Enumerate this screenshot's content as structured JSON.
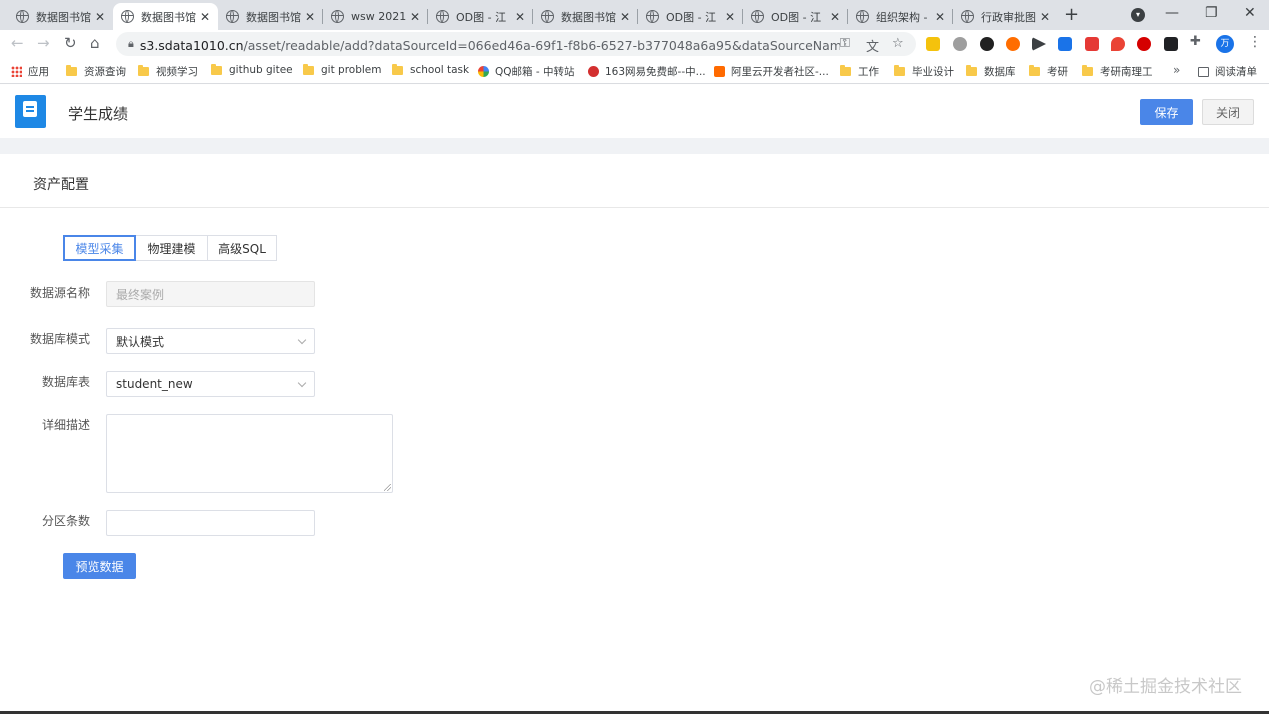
{
  "browser": {
    "tabs": [
      {
        "title": "数据图书馆",
        "active": false
      },
      {
        "title": "数据图书馆",
        "active": true
      },
      {
        "title": "数据图书馆",
        "active": false
      },
      {
        "title": "wsw 2021.",
        "active": false
      },
      {
        "title": "OD图 - 江",
        "active": false
      },
      {
        "title": "数据图书馆",
        "active": false
      },
      {
        "title": "OD图 - 江",
        "active": false
      },
      {
        "title": "OD图 - 江",
        "active": false
      },
      {
        "title": "组织架构 -",
        "active": false
      },
      {
        "title": "行政审批图",
        "active": false
      }
    ],
    "close_glyph": "✕",
    "new_tab_glyph": "+",
    "window_controls": [
      "—",
      "❐",
      "✕"
    ],
    "url_domain": "s3.sdata1010.cn",
    "url_path": "/asset/readable/add?dataSourceId=066ed46a-69f1-f8b6-6527-b377048a6a95&dataSourceName=最终案...",
    "avatar_label": "万",
    "bookmarks": [
      {
        "label": "应用",
        "icon": "apps-grid-icon"
      },
      {
        "label": "资源查询",
        "icon": "folder-icon"
      },
      {
        "label": "视频学习",
        "icon": "folder-icon"
      },
      {
        "label": "github gitee",
        "icon": "folder-icon"
      },
      {
        "label": "git problem",
        "icon": "folder-icon"
      },
      {
        "label": "school task",
        "icon": "folder-icon"
      },
      {
        "label": "QQ邮箱 - 中转站",
        "icon": "qqmail-icon"
      },
      {
        "label": "163网易免费邮--中...",
        "icon": "netease-icon"
      },
      {
        "label": "阿里云开发者社区-...",
        "icon": "aliyun-icon"
      },
      {
        "label": "工作",
        "icon": "folder-icon"
      },
      {
        "label": "毕业设计",
        "icon": "folder-icon"
      },
      {
        "label": "数据库",
        "icon": "folder-icon"
      },
      {
        "label": "考研",
        "icon": "folder-icon"
      },
      {
        "label": "考研南理工",
        "icon": "folder-icon"
      }
    ],
    "bookmarks_more": "»",
    "reading_list": "阅读清单"
  },
  "app": {
    "title": "学生成绩",
    "save_label": "保存",
    "close_label": "关闭",
    "section_title": "资产配置",
    "mode_tabs": [
      {
        "label": "模型采集",
        "active": true
      },
      {
        "label": "物理建模",
        "active": false
      },
      {
        "label": "高级SQL",
        "active": false
      }
    ],
    "form": {
      "datasource_label": "数据源名称",
      "datasource_placeholder": "最终案例",
      "schema_label": "数据库模式",
      "schema_value": "默认模式",
      "table_label": "数据库表",
      "table_value": "student_new",
      "desc_label": "详细描述",
      "partition_label": "分区条数"
    },
    "preview_label": "预览数据"
  },
  "watermark": "@稀土掘金技术社区",
  "colors": {
    "primary": "#4a86e8",
    "logo": "#1e88e5",
    "tabstrip": "#dee1e6"
  }
}
